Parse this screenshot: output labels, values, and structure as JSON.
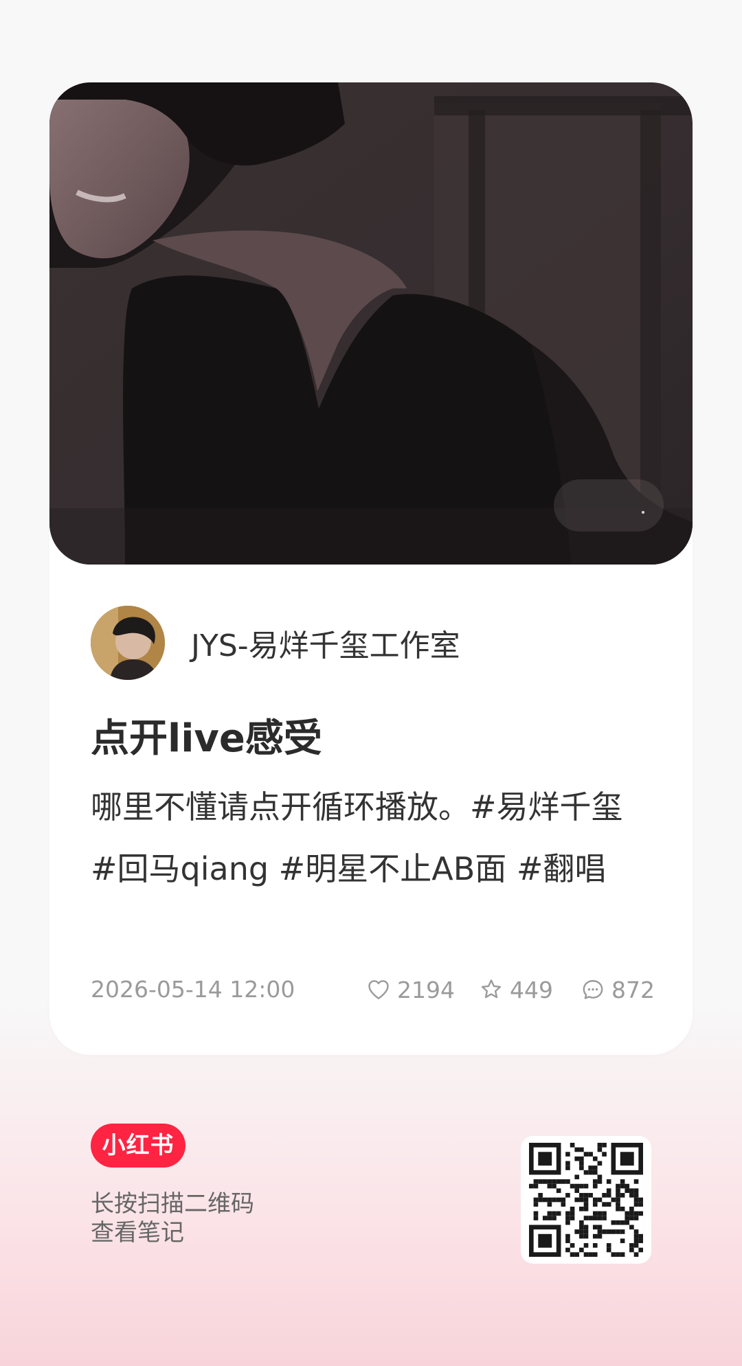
{
  "author": {
    "name": "JYS-易烊千玺工作室"
  },
  "note": {
    "title": "点开live感受",
    "body": "哪里不懂请点开循环播放。#易烊千玺 #回马qiang #明星不止AB面 #翻唱",
    "date": "2026-05-14 12:00",
    "likes": "2194",
    "collects": "449",
    "comments": "872"
  },
  "footer": {
    "brand": "小红书",
    "scan_line1": "长按扫描二维码",
    "scan_line2": "查看笔记"
  },
  "colors": {
    "brand": "#ff2442",
    "meta_text": "#9a9a9a",
    "body_text": "#333333",
    "page_bottom_pink": "#f8d4da"
  },
  "icons": [
    "heart-icon",
    "star-icon",
    "comment-icon",
    "qr-code-icon"
  ]
}
